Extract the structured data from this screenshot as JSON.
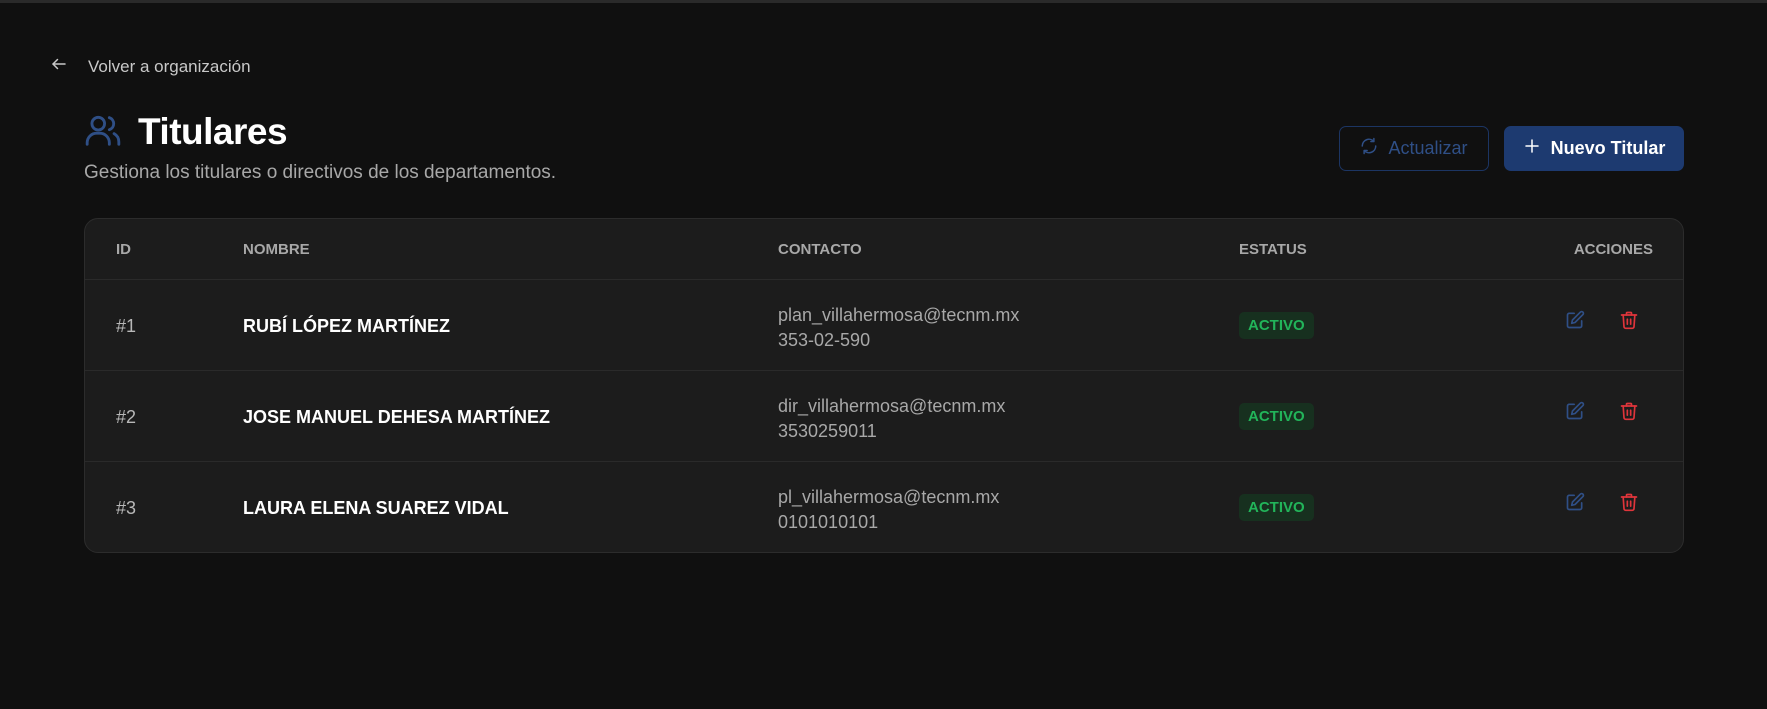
{
  "nav": {
    "back_label": "Volver a organización"
  },
  "header": {
    "title": "Titulares",
    "subtitle": "Gestiona los titulares o directivos de los departamentos."
  },
  "toolbar": {
    "refresh_label": "Actualizar",
    "new_label": "Nuevo Titular"
  },
  "table": {
    "columns": {
      "id": "ID",
      "name": "NOMBRE",
      "contact": "CONTACTO",
      "status": "ESTATUS",
      "actions": "ACCIONES"
    },
    "rows": [
      {
        "id": "#1",
        "name": "RUBÍ LÓPEZ MARTÍNEZ",
        "email": "plan_villahermosa@tecnm.mx",
        "phone": "353-02-590",
        "status": "ACTIVO"
      },
      {
        "id": "#2",
        "name": "JOSE MANUEL DEHESA MARTÍNEZ",
        "email": "dir_villahermosa@tecnm.mx",
        "phone": "3530259011",
        "status": "ACTIVO"
      },
      {
        "id": "#3",
        "name": "LAURA ELENA SUAREZ VIDAL",
        "email": "pl_villahermosa@tecnm.mx",
        "phone": "0101010101",
        "status": "ACTIVO"
      }
    ]
  },
  "icons": {
    "back": "arrow-left-icon",
    "title": "users-icon",
    "refresh": "refresh-icon",
    "new": "plus-icon",
    "edit": "edit-icon",
    "delete": "trash-icon"
  },
  "colors": {
    "background": "#101010",
    "card": "#1c1c1c",
    "primary": "#1d3a70",
    "accent_blue": "#2f4f86",
    "status_active": "#22b45a",
    "danger": "#e0353b"
  }
}
